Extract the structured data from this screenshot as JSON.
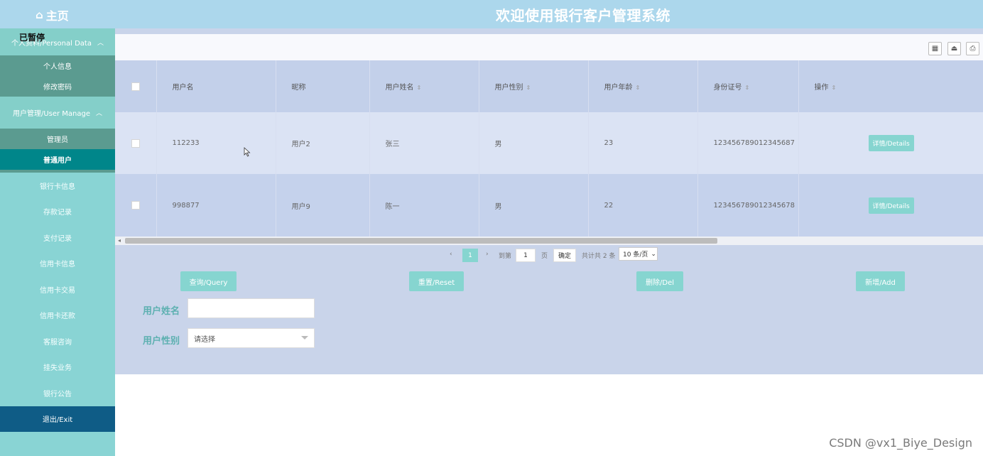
{
  "header": {
    "home_label": "主页",
    "home_icon": "home-icon",
    "title": "欢迎使用银行客户管理系统"
  },
  "overlay": {
    "paused_label": "已暂停"
  },
  "sidebar": {
    "groups": [
      {
        "label": "个人资料/Personal Data",
        "items": [
          {
            "label": "个人信息"
          },
          {
            "label": "修改密码"
          }
        ]
      },
      {
        "label": "用户管理/User Manage",
        "items": [
          {
            "label": "管理员"
          },
          {
            "label": "普通用户",
            "active": true
          }
        ]
      }
    ],
    "items": [
      {
        "label": "银行卡信息"
      },
      {
        "label": "存款记录"
      },
      {
        "label": "支付记录"
      },
      {
        "label": "信用卡信息"
      },
      {
        "label": "信用卡交易"
      },
      {
        "label": "信用卡还款"
      },
      {
        "label": "客服咨询"
      },
      {
        "label": "挂失业务"
      },
      {
        "label": "银行公告"
      }
    ],
    "exit_label": "退出/Exit"
  },
  "toolbar": {
    "icons": [
      "columns-icon",
      "export-icon",
      "print-icon"
    ]
  },
  "table": {
    "columns": [
      "用户名",
      "昵称",
      "用户姓名",
      "用户性别",
      "用户年龄",
      "身份证号",
      "操作"
    ],
    "rows": [
      {
        "username": "112233",
        "nickname": "用户2",
        "name": "张三",
        "gender": "男",
        "age": "23",
        "id_number": "123456789012345687",
        "action": "详情/Details"
      },
      {
        "username": "998877",
        "nickname": "用户9",
        "name": "陈一",
        "gender": "男",
        "age": "22",
        "id_number": "123456789012345678",
        "action": "详情/Details"
      }
    ]
  },
  "pager": {
    "current_page": "1",
    "goto_label": "到第",
    "goto_value": "1",
    "page_unit": "页",
    "confirm_label": "确定",
    "total_label": "共计共 2 条",
    "page_size": "10 条/页"
  },
  "actions": {
    "query": "查询/Query",
    "reset": "重置/Reset",
    "delete": "删除/Del",
    "add": "新增/Add"
  },
  "search": {
    "name_label": "用户姓名",
    "name_value": "",
    "gender_label": "用户性别",
    "gender_placeholder": "请选择"
  },
  "watermark": "CSDN @vx1_Biye_Design",
  "colors": {
    "header_bg": "#acd7ec",
    "sidebar_bg": "#89d4d4",
    "sidebar_active": "#00868a",
    "exit_bg": "#0f5c86",
    "accent": "#86d5d0",
    "panel_bg": "#c9d4ea"
  }
}
